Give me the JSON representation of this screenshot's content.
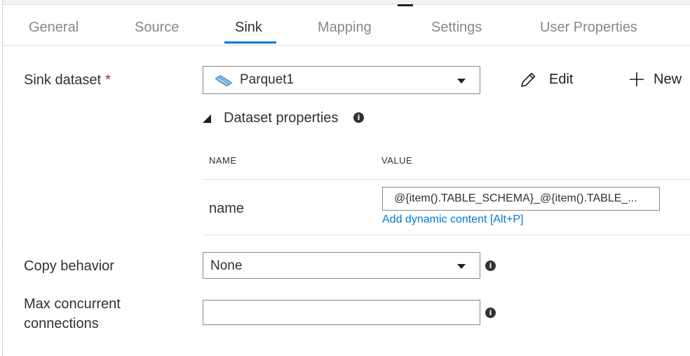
{
  "tabs": [
    {
      "label": "General"
    },
    {
      "label": "Source"
    },
    {
      "label": "Sink"
    },
    {
      "label": "Mapping"
    },
    {
      "label": "Settings"
    },
    {
      "label": "User Properties"
    }
  ],
  "active_tab": "Sink",
  "sink_dataset": {
    "label": "Sink dataset",
    "required_mark": "*",
    "selected": "Parquet1",
    "edit_label": "Edit",
    "new_label": "New"
  },
  "dataset_properties": {
    "title": "Dataset properties",
    "columns": {
      "name": "NAME",
      "value": "VALUE"
    },
    "rows": [
      {
        "name": "name",
        "value": "@{item().TABLE_SCHEMA}_@{item().TABLE_...",
        "dynamic_link": "Add dynamic content [Alt+P]"
      }
    ]
  },
  "copy_behavior": {
    "label": "Copy behavior",
    "selected": "None"
  },
  "max_concurrent": {
    "label_line1": "Max concurrent",
    "label_line2": "connections",
    "value": ""
  },
  "info_glyph": "i",
  "colors": {
    "accent": "#0078d4",
    "required": "#a4262c",
    "text": "#323130",
    "muted": "#8a8886"
  }
}
